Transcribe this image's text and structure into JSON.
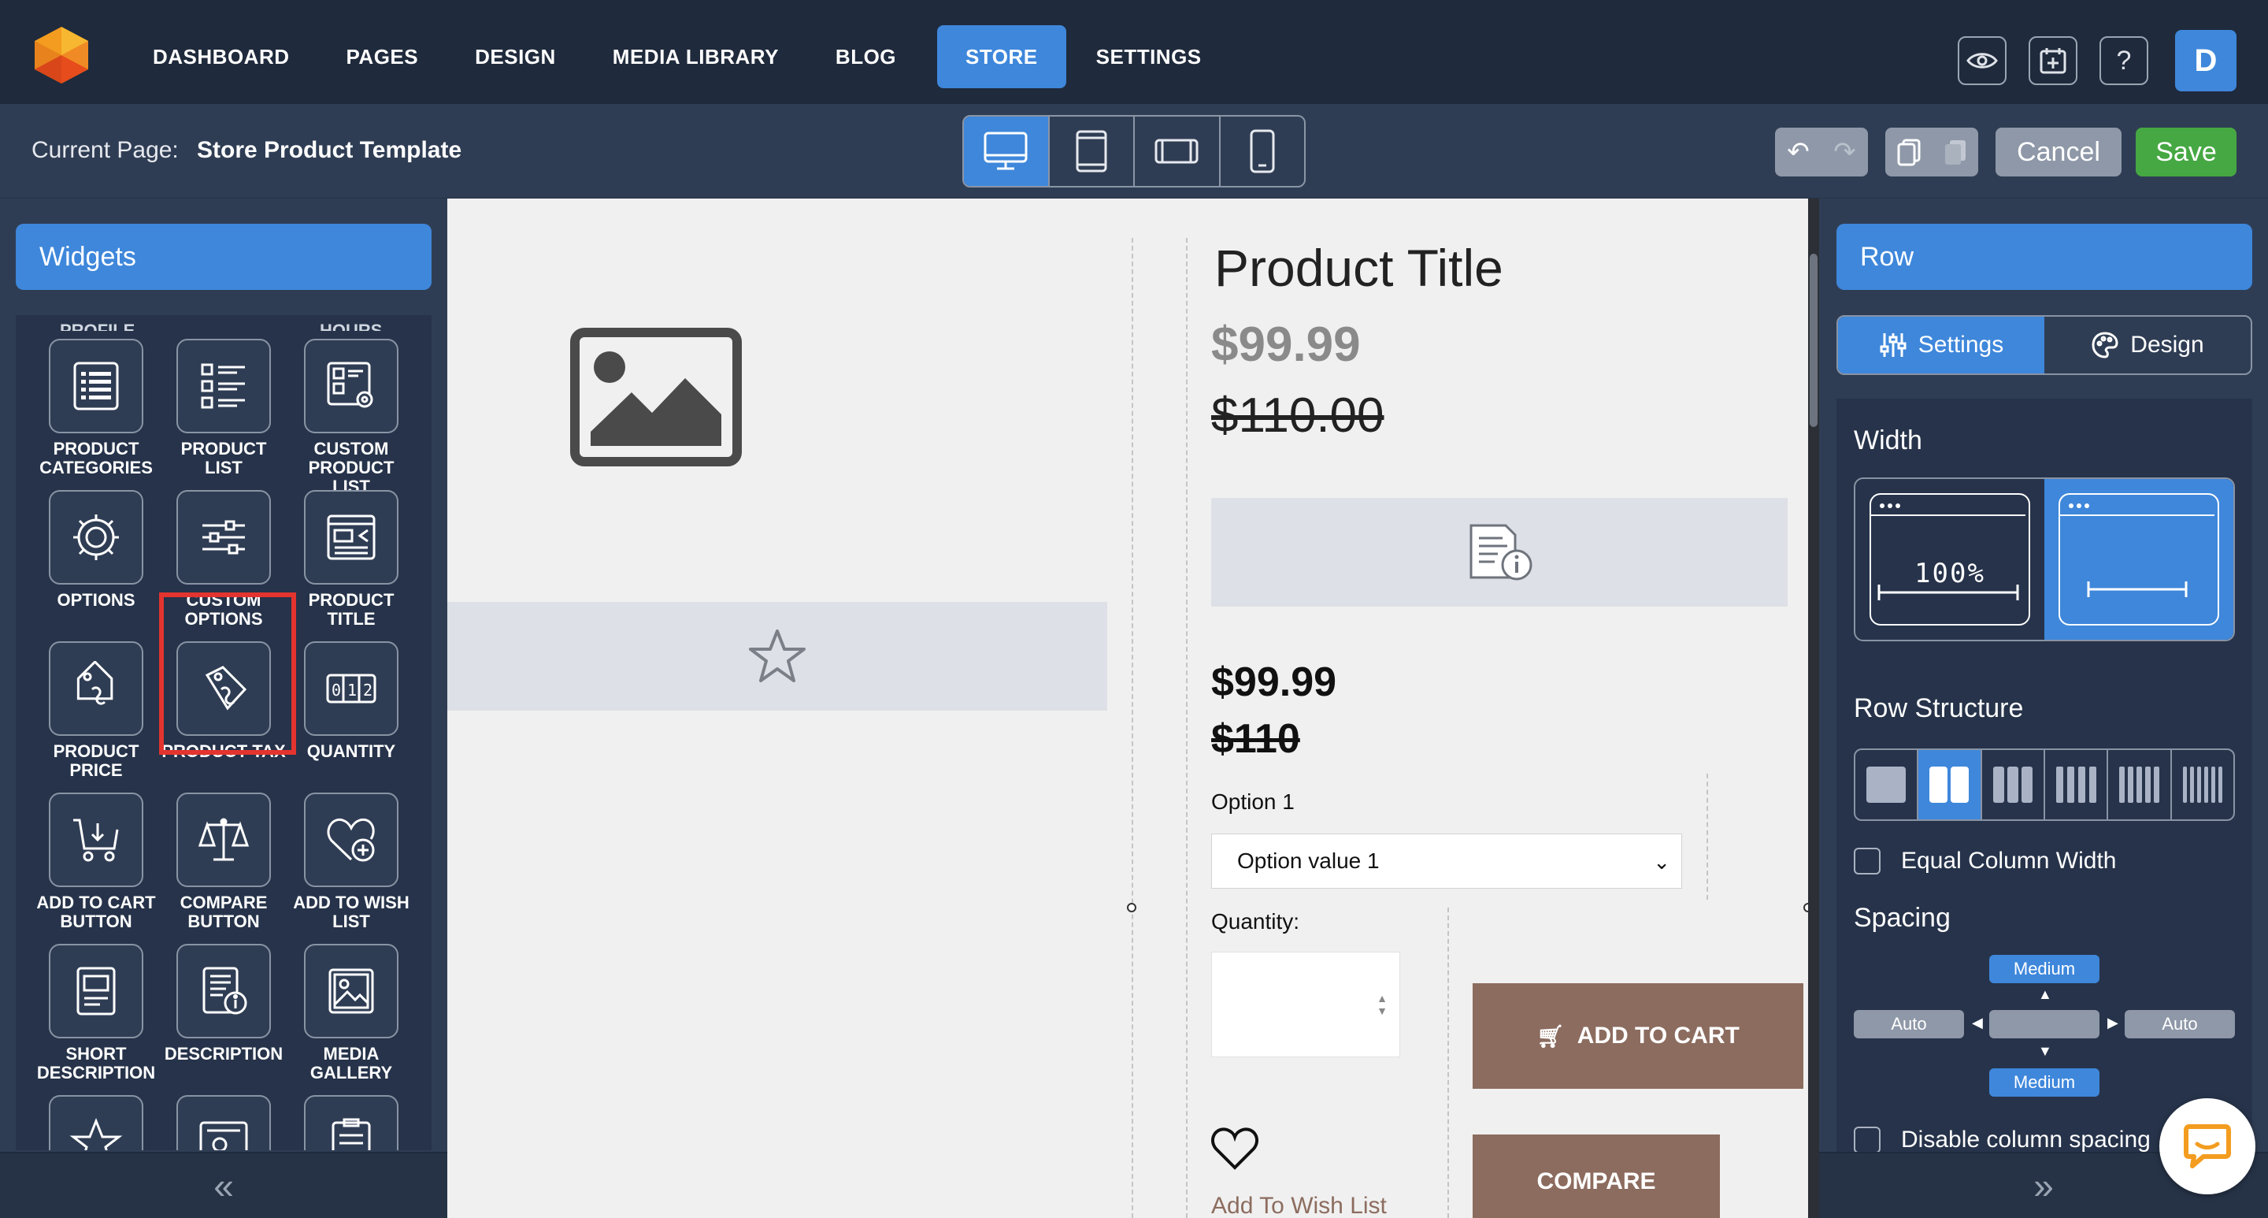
{
  "nav": {
    "items": [
      {
        "label": "DASHBOARD",
        "active": false
      },
      {
        "label": "PAGES",
        "active": false
      },
      {
        "label": "DESIGN",
        "active": false
      },
      {
        "label": "MEDIA LIBRARY",
        "active": false
      },
      {
        "label": "BLOG",
        "active": false
      },
      {
        "label": "STORE",
        "active": true
      },
      {
        "label": "SETTINGS",
        "active": false
      }
    ],
    "help_label": "?",
    "avatar_initial": "D"
  },
  "subbar": {
    "current_page_label": "Current Page:",
    "current_page_value": "Store Product Template",
    "cancel_label": "Cancel",
    "save_label": "Save"
  },
  "widgets": {
    "header": "Widgets",
    "cut_labels": [
      "PROFILE",
      "HOURS"
    ],
    "items": [
      {
        "label": "PRODUCT CATEGORIES",
        "icon": "list-icon"
      },
      {
        "label": "PRODUCT LIST",
        "icon": "product-list-icon"
      },
      {
        "label": "CUSTOM PRODUCT LIST",
        "icon": "custom-product-list-icon"
      },
      {
        "label": "OPTIONS",
        "icon": "gear-icon"
      },
      {
        "label": "CUSTOM OPTIONS",
        "icon": "sliders-icon"
      },
      {
        "label": "PRODUCT TITLE",
        "icon": "product-title-icon"
      },
      {
        "label": "PRODUCT PRICE",
        "icon": "price-tag-icon"
      },
      {
        "label": "PRODUCT TAX",
        "icon": "tax-tag-icon"
      },
      {
        "label": "QUANTITY",
        "icon": "quantity-icon"
      },
      {
        "label": "ADD TO CART BUTTON",
        "icon": "cart-icon"
      },
      {
        "label": "COMPARE BUTTON",
        "icon": "scale-icon"
      },
      {
        "label": "ADD TO WISH LIST",
        "icon": "heart-plus-icon"
      },
      {
        "label": "SHORT DESCRIPTION",
        "icon": "short-description-icon"
      },
      {
        "label": "DESCRIPTION",
        "icon": "description-icon"
      },
      {
        "label": "MEDIA GALLERY",
        "icon": "gallery-icon"
      },
      {
        "label": "",
        "icon": "star-icon"
      },
      {
        "label": "",
        "icon": "review-icon"
      },
      {
        "label": "",
        "icon": "form-icon"
      }
    ]
  },
  "canvas": {
    "product_title": "Product Title",
    "price_sale": "$99.99",
    "price_original": "$110.00",
    "price_sale_2": "$99.99",
    "price_original_2": "$110",
    "option_label": "Option 1",
    "option_value": "Option value 1",
    "quantity_label": "Quantity:",
    "add_to_cart_label": "ADD TO CART",
    "wish_list_label": "Add To Wish List",
    "compare_label": "COMPARE"
  },
  "right_panel": {
    "header": "Row",
    "tabs": [
      {
        "label": "Settings",
        "active": true
      },
      {
        "label": "Design",
        "active": false
      }
    ],
    "width_label": "Width",
    "width_full_text": "100%",
    "row_structure_label": "Row Structure",
    "equal_column_label": "Equal Column Width",
    "spacing_label": "Spacing",
    "spacing_top": "Medium",
    "spacing_bottom": "Medium",
    "spacing_left": "Auto",
    "spacing_right": "Auto",
    "disable_spacing_label": "Disable column spacing"
  },
  "colors": {
    "accent": "#3e87db",
    "save": "#46a843",
    "button_brown": "#8c6c5f",
    "highlight": "#e3342f"
  }
}
